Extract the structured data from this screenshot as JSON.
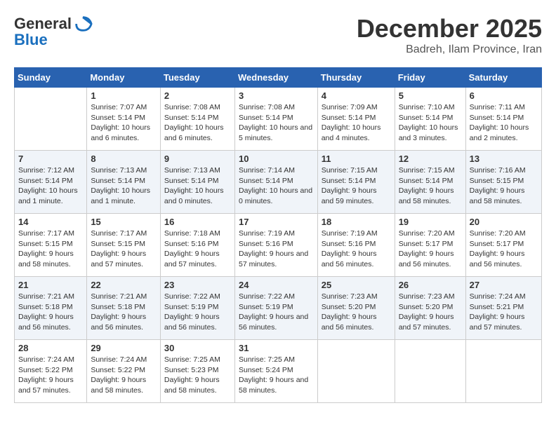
{
  "header": {
    "logo": {
      "general": "General",
      "blue": "Blue"
    },
    "month": "December 2025",
    "location": "Badreh, Ilam Province, Iran"
  },
  "weekdays": [
    "Sunday",
    "Monday",
    "Tuesday",
    "Wednesday",
    "Thursday",
    "Friday",
    "Saturday"
  ],
  "weeks": [
    [
      {
        "day": "",
        "info": ""
      },
      {
        "day": "1",
        "sunrise": "7:07 AM",
        "sunset": "5:14 PM",
        "daylight": "10 hours and 6 minutes."
      },
      {
        "day": "2",
        "sunrise": "7:08 AM",
        "sunset": "5:14 PM",
        "daylight": "10 hours and 6 minutes."
      },
      {
        "day": "3",
        "sunrise": "7:08 AM",
        "sunset": "5:14 PM",
        "daylight": "10 hours and 5 minutes."
      },
      {
        "day": "4",
        "sunrise": "7:09 AM",
        "sunset": "5:14 PM",
        "daylight": "10 hours and 4 minutes."
      },
      {
        "day": "5",
        "sunrise": "7:10 AM",
        "sunset": "5:14 PM",
        "daylight": "10 hours and 3 minutes."
      },
      {
        "day": "6",
        "sunrise": "7:11 AM",
        "sunset": "5:14 PM",
        "daylight": "10 hours and 2 minutes."
      }
    ],
    [
      {
        "day": "7",
        "sunrise": "7:12 AM",
        "sunset": "5:14 PM",
        "daylight": "10 hours and 1 minute."
      },
      {
        "day": "8",
        "sunrise": "7:13 AM",
        "sunset": "5:14 PM",
        "daylight": "10 hours and 1 minute."
      },
      {
        "day": "9",
        "sunrise": "7:13 AM",
        "sunset": "5:14 PM",
        "daylight": "10 hours and 0 minutes."
      },
      {
        "day": "10",
        "sunrise": "7:14 AM",
        "sunset": "5:14 PM",
        "daylight": "10 hours and 0 minutes."
      },
      {
        "day": "11",
        "sunrise": "7:15 AM",
        "sunset": "5:14 PM",
        "daylight": "9 hours and 59 minutes."
      },
      {
        "day": "12",
        "sunrise": "7:15 AM",
        "sunset": "5:14 PM",
        "daylight": "9 hours and 58 minutes."
      },
      {
        "day": "13",
        "sunrise": "7:16 AM",
        "sunset": "5:15 PM",
        "daylight": "9 hours and 58 minutes."
      }
    ],
    [
      {
        "day": "14",
        "sunrise": "7:17 AM",
        "sunset": "5:15 PM",
        "daylight": "9 hours and 58 minutes."
      },
      {
        "day": "15",
        "sunrise": "7:17 AM",
        "sunset": "5:15 PM",
        "daylight": "9 hours and 57 minutes."
      },
      {
        "day": "16",
        "sunrise": "7:18 AM",
        "sunset": "5:16 PM",
        "daylight": "9 hours and 57 minutes."
      },
      {
        "day": "17",
        "sunrise": "7:19 AM",
        "sunset": "5:16 PM",
        "daylight": "9 hours and 57 minutes."
      },
      {
        "day": "18",
        "sunrise": "7:19 AM",
        "sunset": "5:16 PM",
        "daylight": "9 hours and 56 minutes."
      },
      {
        "day": "19",
        "sunrise": "7:20 AM",
        "sunset": "5:17 PM",
        "daylight": "9 hours and 56 minutes."
      },
      {
        "day": "20",
        "sunrise": "7:20 AM",
        "sunset": "5:17 PM",
        "daylight": "9 hours and 56 minutes."
      }
    ],
    [
      {
        "day": "21",
        "sunrise": "7:21 AM",
        "sunset": "5:18 PM",
        "daylight": "9 hours and 56 minutes."
      },
      {
        "day": "22",
        "sunrise": "7:21 AM",
        "sunset": "5:18 PM",
        "daylight": "9 hours and 56 minutes."
      },
      {
        "day": "23",
        "sunrise": "7:22 AM",
        "sunset": "5:19 PM",
        "daylight": "9 hours and 56 minutes."
      },
      {
        "day": "24",
        "sunrise": "7:22 AM",
        "sunset": "5:19 PM",
        "daylight": "9 hours and 56 minutes."
      },
      {
        "day": "25",
        "sunrise": "7:23 AM",
        "sunset": "5:20 PM",
        "daylight": "9 hours and 56 minutes."
      },
      {
        "day": "26",
        "sunrise": "7:23 AM",
        "sunset": "5:20 PM",
        "daylight": "9 hours and 57 minutes."
      },
      {
        "day": "27",
        "sunrise": "7:24 AM",
        "sunset": "5:21 PM",
        "daylight": "9 hours and 57 minutes."
      }
    ],
    [
      {
        "day": "28",
        "sunrise": "7:24 AM",
        "sunset": "5:22 PM",
        "daylight": "9 hours and 57 minutes."
      },
      {
        "day": "29",
        "sunrise": "7:24 AM",
        "sunset": "5:22 PM",
        "daylight": "9 hours and 58 minutes."
      },
      {
        "day": "30",
        "sunrise": "7:25 AM",
        "sunset": "5:23 PM",
        "daylight": "9 hours and 58 minutes."
      },
      {
        "day": "31",
        "sunrise": "7:25 AM",
        "sunset": "5:24 PM",
        "daylight": "9 hours and 58 minutes."
      },
      {
        "day": "",
        "info": ""
      },
      {
        "day": "",
        "info": ""
      },
      {
        "day": "",
        "info": ""
      }
    ]
  ]
}
